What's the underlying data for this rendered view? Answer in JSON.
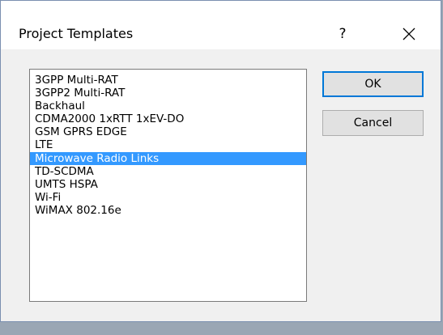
{
  "dialog": {
    "title": "Project Templates",
    "help_label": "?",
    "close_label": "✕"
  },
  "templates": {
    "selected_index": 6,
    "items": [
      "3GPP Multi-RAT",
      "3GPP2 Multi-RAT",
      "Backhaul",
      "CDMA2000 1xRTT 1xEV-DO",
      "GSM GPRS EDGE",
      "LTE",
      "Microwave Radio Links",
      "TD-SCDMA",
      "UMTS HSPA",
      "Wi-Fi",
      "WiMAX 802.16e"
    ]
  },
  "buttons": {
    "ok_label": "OK",
    "cancel_label": "Cancel"
  },
  "colors": {
    "selection": "#3399ff",
    "default_button_border": "#0078d7"
  }
}
